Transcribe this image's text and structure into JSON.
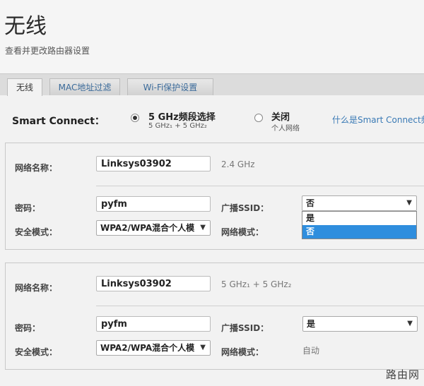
{
  "header": {
    "title": "无线",
    "subtitle": "查看并更改路由器设置"
  },
  "tabs": [
    {
      "label": "无线",
      "active": true
    },
    {
      "label": "MAC地址过滤",
      "active": false
    },
    {
      "label": "Wi-Fi保护设置",
      "active": false
    }
  ],
  "smart_connect": {
    "label": "Smart Connect：",
    "option_on": {
      "title": "5 GHz频段选择",
      "sub": "5 GHz₁ + 5 GHz₂",
      "selected": true
    },
    "option_off": {
      "title": "关闭",
      "sub": "个人网络",
      "selected": false
    },
    "help_link": "什么是Smart Connect频"
  },
  "panel1": {
    "network_name_label": "网络名称：",
    "network_name_value": "Linksys03902",
    "band": "2.4 GHz",
    "password_label": "密码：",
    "password_value": "pyfm",
    "broadcast_label": "广播SSID：",
    "broadcast_value": "否",
    "broadcast_options": [
      "是",
      "否"
    ],
    "broadcast_highlighted": "否",
    "security_label": "安全模式：",
    "security_value": "WPA2/WPA混合个人模",
    "network_mode_label": "网络模式："
  },
  "panel2": {
    "network_name_label": "网络名称：",
    "network_name_value": "Linksys03902",
    "band": "5 GHz₁ + 5 GHz₂",
    "password_label": "密码：",
    "password_value": "pyfm",
    "broadcast_label": "广播SSID：",
    "broadcast_value": "是",
    "security_label": "安全模式：",
    "security_value": "WPA2/WPA混合个人模",
    "network_mode_label": "网络模式：",
    "network_mode_value": "自动"
  },
  "watermark": "路由网",
  "colors": {
    "link": "#3a7ab5",
    "highlight": "#2f8ede"
  }
}
